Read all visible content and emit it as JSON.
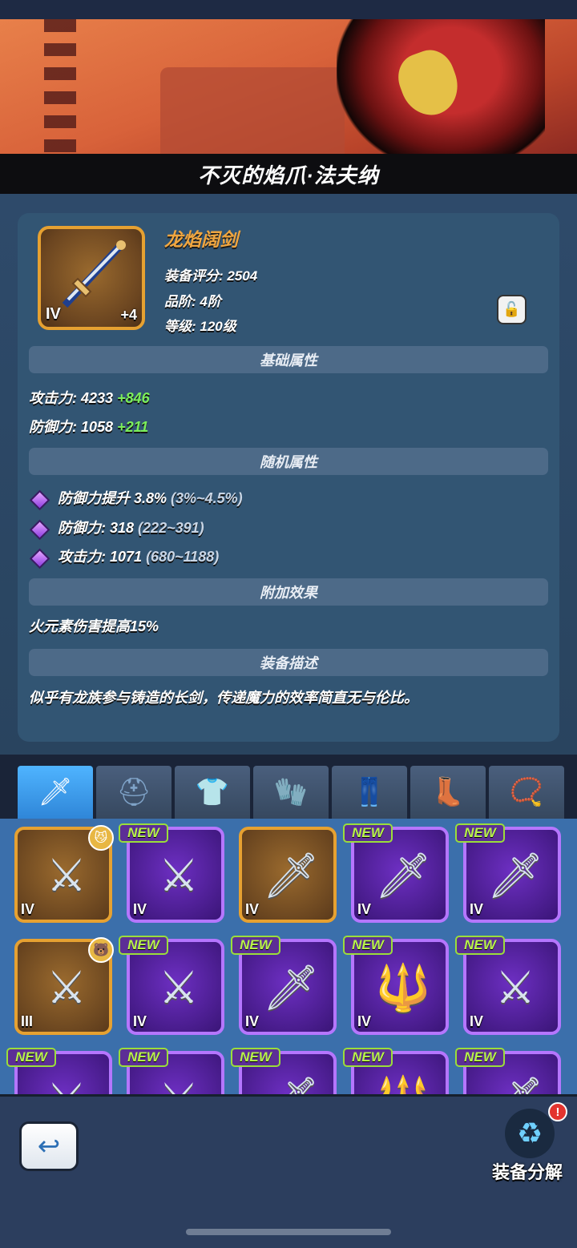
{
  "banner": {
    "title": "不灭的焰爪·法夫纳"
  },
  "item": {
    "name": "龙焰阔剑",
    "grade": "IV",
    "enhance": "+4",
    "score": "装备评分: 2504",
    "tier": "品阶: 4阶",
    "level": "等级: 120级"
  },
  "sections": {
    "basic": "基础属性",
    "random": "随机属性",
    "extra": "附加效果",
    "desc": "装备描述"
  },
  "basic_attrs": [
    {
      "label": "攻击力: 4233",
      "bonus": "+846"
    },
    {
      "label": "防御力: 1058",
      "bonus": "+211"
    }
  ],
  "random_attrs": [
    {
      "label": "防御力提升 3.8%",
      "range": "(3%~4.5%)"
    },
    {
      "label": "防御力: 318",
      "range": "(222~391)"
    },
    {
      "label": "攻击力: 1071",
      "range": "(680~1188)"
    }
  ],
  "extra_effect": "火元素伤害提高15%",
  "description": "似乎有龙族参与铸造的长剑，传递魔力的效率简直无与伦比。",
  "tabs": [
    "sword-icon",
    "helmet-icon",
    "armor-icon",
    "gauntlet-icon",
    "pants-icon",
    "boots-icon",
    "necklace-icon"
  ],
  "inventory": {
    "new_label": "NEW",
    "rows": [
      [
        {
          "grade": "IV",
          "rarity": "gold",
          "icon": "axe-icon",
          "new": false,
          "equipped": true
        },
        {
          "grade": "IV",
          "rarity": "purple",
          "icon": "axe-icon",
          "new": true,
          "equipped": false
        },
        {
          "grade": "IV",
          "rarity": "gold",
          "icon": "sword-icon",
          "new": false,
          "equipped": false
        },
        {
          "grade": "IV",
          "rarity": "purple",
          "icon": "sword-icon",
          "new": true,
          "equipped": false
        },
        {
          "grade": "IV",
          "rarity": "purple",
          "icon": "sword-icon",
          "new": true,
          "equipped": false
        }
      ],
      [
        {
          "grade": "III",
          "rarity": "gold",
          "icon": "axe-icon",
          "new": false,
          "equipped": true
        },
        {
          "grade": "IV",
          "rarity": "purple",
          "icon": "axe-icon",
          "new": true,
          "equipped": false
        },
        {
          "grade": "IV",
          "rarity": "purple",
          "icon": "sword-icon",
          "new": true,
          "equipped": false
        },
        {
          "grade": "IV",
          "rarity": "purple",
          "icon": "staff-icon",
          "new": true,
          "equipped": false
        },
        {
          "grade": "IV",
          "rarity": "purple",
          "icon": "axe-icon",
          "new": true,
          "equipped": false
        }
      ]
    ]
  },
  "footer": {
    "decompose_label": "装备分解",
    "alert": "!"
  },
  "colors": {
    "accent_gold": "#e6a131",
    "rarity_purple": "#b576ff",
    "bonus_green": "#7bef5a",
    "tab_active": "#4fb4ff"
  }
}
